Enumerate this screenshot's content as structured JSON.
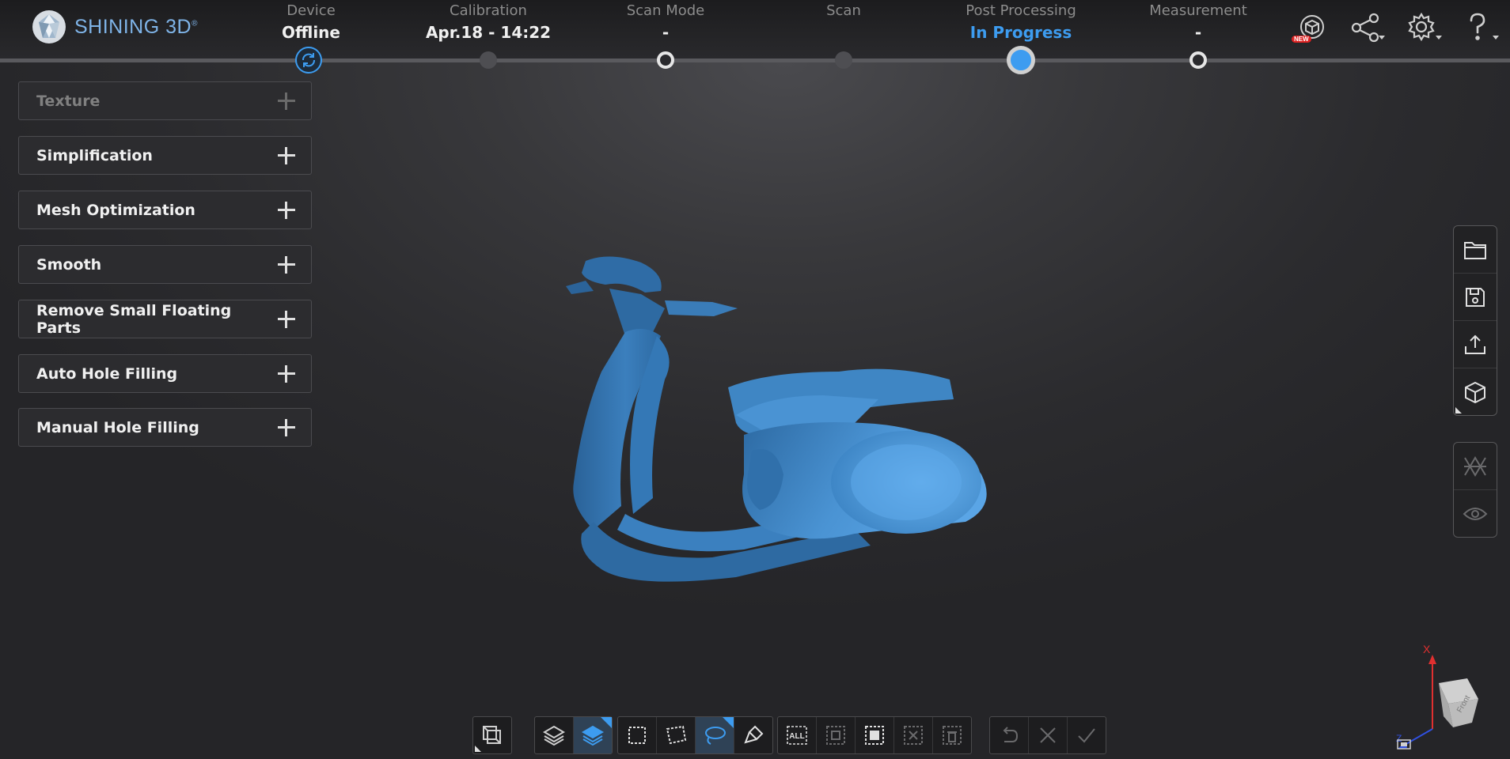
{
  "brand": {
    "name": "SHINING 3D",
    "mark": "®"
  },
  "steps": [
    {
      "label": "Device",
      "value": "Offline",
      "state": "sync"
    },
    {
      "label": "Calibration",
      "value": "Apr.18 - 14:22",
      "state": "plain"
    },
    {
      "label": "Scan Mode",
      "value": "-",
      "state": "ring"
    },
    {
      "label": "Scan",
      "value": "",
      "state": "plain"
    },
    {
      "label": "Post Processing",
      "value": "In Progress",
      "state": "active"
    },
    {
      "label": "Measurement",
      "value": "-",
      "state": "ring"
    }
  ],
  "top_icons": {
    "new_badge": "NEW",
    "icons": [
      "3d-model-new-icon",
      "share-icon",
      "settings-icon",
      "help-icon"
    ]
  },
  "panels": [
    {
      "label": "Texture",
      "enabled": false
    },
    {
      "label": "Simplification",
      "enabled": true
    },
    {
      "label": "Mesh Optimization",
      "enabled": true
    },
    {
      "label": "Smooth",
      "enabled": true
    },
    {
      "label": "Remove Small Floating Parts",
      "enabled": true
    },
    {
      "label": "Auto Hole Filling",
      "enabled": true
    },
    {
      "label": "Manual Hole Filling",
      "enabled": true
    }
  ],
  "right_toolbar": {
    "file_group": [
      "open-folder-icon",
      "save-icon",
      "export-icon",
      "model-cube-icon"
    ],
    "view_group": [
      "mesh-view-icon",
      "visibility-icon"
    ]
  },
  "bottom_toolbar": {
    "select_all_label": "ALL"
  },
  "axes": {
    "x": "X",
    "z": "Z",
    "cube_face": "Front"
  },
  "colors": {
    "accent": "#3d9cf0",
    "model": "#3f86c4",
    "background": "#2b2b2e"
  }
}
